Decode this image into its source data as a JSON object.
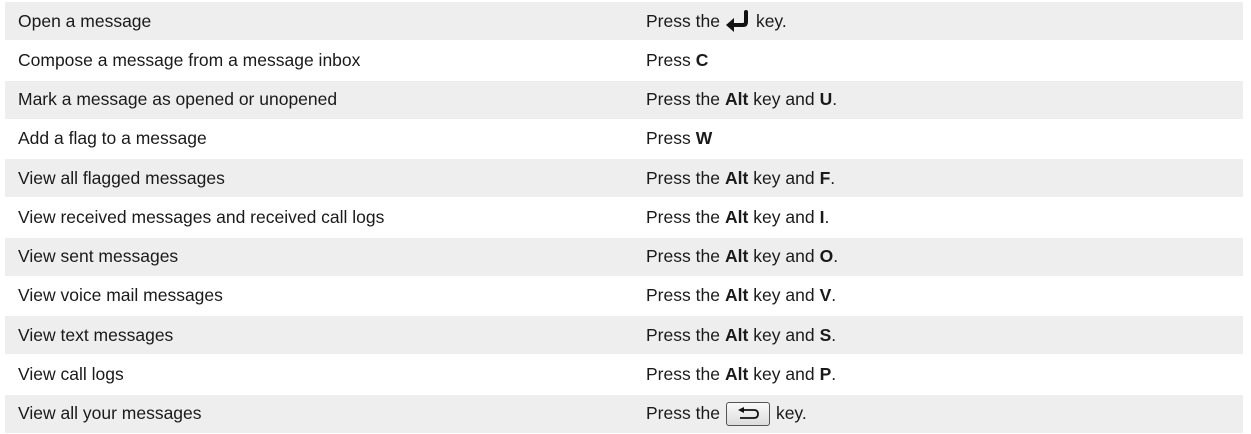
{
  "rows": [
    {
      "action": "Open a message",
      "key": {
        "prefix": "Press the",
        "icon": "enter-key-icon",
        "suffix": "key."
      }
    },
    {
      "action": "Compose a message from a message inbox",
      "key": {
        "prefix": "Press",
        "bold1": "C"
      }
    },
    {
      "action": "Mark a message as opened or unopened",
      "key": {
        "prefix": "Press the",
        "bold1": "Alt",
        "mid": "key and",
        "bold2": "U",
        "end": "."
      }
    },
    {
      "action": "Add a flag to a message",
      "key": {
        "prefix": "Press",
        "bold1": "W"
      }
    },
    {
      "action": "View all flagged messages",
      "key": {
        "prefix": "Press the",
        "bold1": "Alt",
        "mid": "key and",
        "bold2": "F",
        "end": "."
      }
    },
    {
      "action": "View received messages and received call logs",
      "key": {
        "prefix": "Press the",
        "bold1": "Alt",
        "mid": "key and",
        "bold2": "I",
        "end": "."
      }
    },
    {
      "action": "View sent messages",
      "key": {
        "prefix": "Press the",
        "bold1": "Alt",
        "mid": "key and",
        "bold2": "O",
        "end": "."
      }
    },
    {
      "action": "View voice mail messages",
      "key": {
        "prefix": "Press the",
        "bold1": "Alt",
        "mid": "key and",
        "bold2": "V",
        "end": "."
      }
    },
    {
      "action": "View text messages",
      "key": {
        "prefix": "Press the",
        "bold1": "Alt",
        "mid": "key and",
        "bold2": "S",
        "end": "."
      }
    },
    {
      "action": "View call logs",
      "key": {
        "prefix": "Press the",
        "bold1": "Alt",
        "mid": "key and",
        "bold2": "P",
        "end": "."
      }
    },
    {
      "action": "View all your messages",
      "key": {
        "prefix": "Press the",
        "icon": "escape-back-key-icon",
        "suffix": "key."
      }
    }
  ]
}
